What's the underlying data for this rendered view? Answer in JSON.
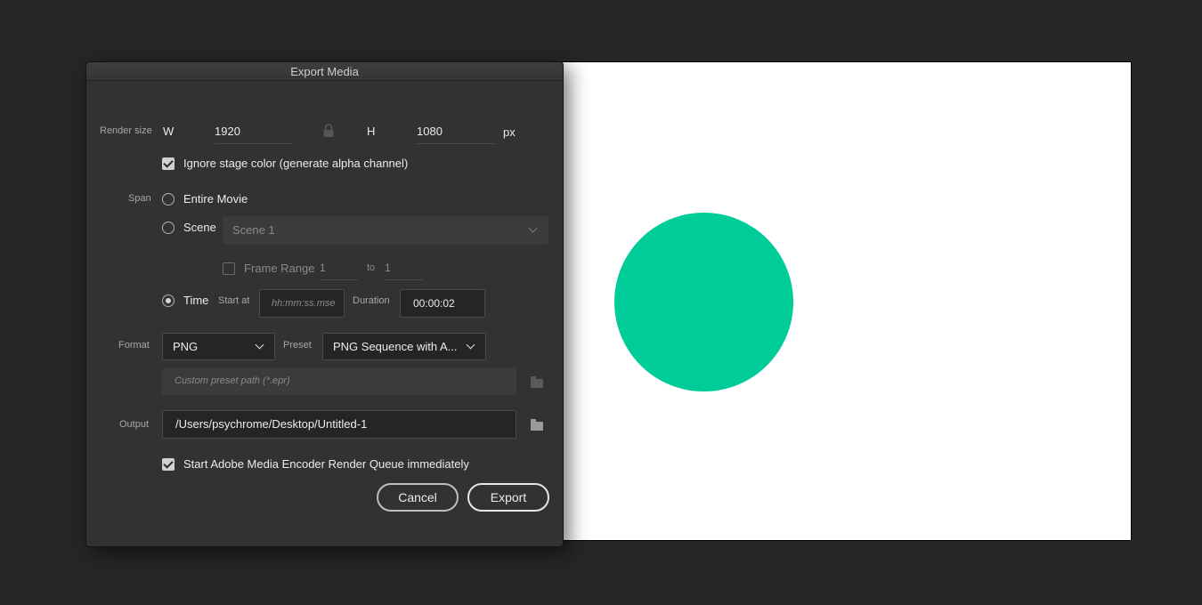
{
  "dialog": {
    "title": "Export Media",
    "render_size": {
      "label": "Render size",
      "w_label": "W",
      "w_value": "1920",
      "h_label": "H",
      "h_value": "1080",
      "unit": "px",
      "lock_icon": "lock-icon"
    },
    "ignore_stage_color": {
      "label": "Ignore stage color (generate alpha channel)",
      "checked": true
    },
    "span": {
      "label": "Span",
      "entire_movie": "Entire Movie",
      "scene": "Scene",
      "scene_select_value": "Scene 1",
      "frame_range_label": "Frame Range",
      "frame_from": "1",
      "frame_to_label": "to",
      "frame_to": "1",
      "time": "Time",
      "start_at_label": "Start at",
      "start_at_placeholder": "hh:mm:ss.mse",
      "duration_label": "Duration",
      "duration_value": "00:00:02",
      "selected": "time"
    },
    "format": {
      "label": "Format",
      "value": "PNG",
      "preset_label": "Preset",
      "preset_value": "PNG Sequence with A...",
      "custom_preset_placeholder": "Custom preset path (*.epr)"
    },
    "output": {
      "label": "Output",
      "path": "/Users/psychrome/Desktop/Untitled-1"
    },
    "start_encoder": {
      "label": "Start Adobe Media Encoder Render Queue immediately",
      "checked": true
    },
    "buttons": {
      "cancel": "Cancel",
      "export": "Export"
    }
  },
  "stage": {
    "background": "#ffffff",
    "circle_color": "#00cc99"
  },
  "colors": {
    "app_background": "#262626",
    "dialog_background": "#323232",
    "folder_icon": "#9a9a9a",
    "folder_icon_disabled": "#5a5a5a"
  }
}
